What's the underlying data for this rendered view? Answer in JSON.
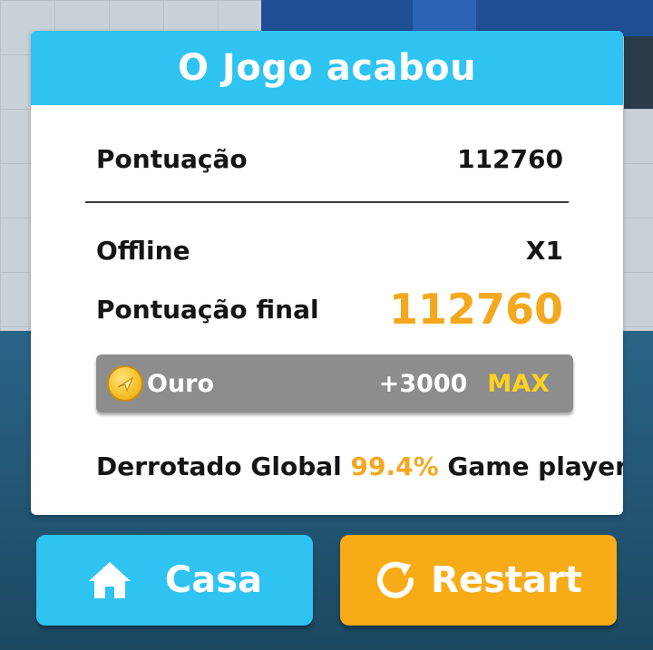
{
  "dialog": {
    "title": "O Jogo acabou",
    "score_label": "Pontuação",
    "score_value": "112760",
    "mode_label": "Offline",
    "multiplier": "X1",
    "final_label": "Pontuação final",
    "final_value": "112760",
    "gold": {
      "icon": "coin-icon",
      "label": "Ouro",
      "amount": "+3000",
      "badge": "MAX"
    },
    "defeated": {
      "prefix": "Derrotado Global",
      "percent": "99.4%",
      "suffix": "Game players"
    }
  },
  "buttons": {
    "home": {
      "icon": "home-icon",
      "label": "Casa"
    },
    "restart": {
      "icon": "restart-icon",
      "label": "Restart"
    }
  },
  "colors": {
    "header": "#2fc3f1",
    "accent_orange": "#f4a81f",
    "max_yellow": "#ffd21f",
    "home_button": "#2fc3f1",
    "restart_button": "#f7ac17"
  }
}
